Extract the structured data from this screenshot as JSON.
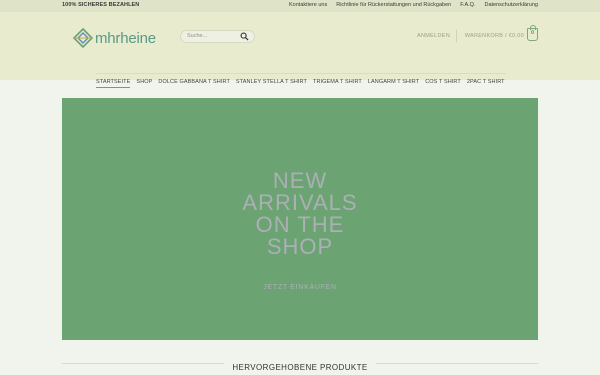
{
  "topbar": {
    "secure_payment": "100% SICHERES BEZAHLEN",
    "links": [
      "Kontaktiere uns",
      "Richtlinie für Rückerstattungen und Rückgaben",
      "F.A.Q.",
      "Datenschutzerklärung"
    ]
  },
  "header": {
    "logo_text": "mhrheine",
    "search_placeholder": "Suche...",
    "account_label": "ANMELDEN",
    "cart_label": "WARENKORB / €0.00",
    "cart_count": "0"
  },
  "nav": {
    "items": [
      "STARTSEITE",
      "SHOP",
      "DOLCE GABBANA T SHIRT",
      "STANLEY STELLA T SHIRT",
      "TRIGEMA T SHIRT",
      "LANGARM T SHIRT",
      "COS T SHIRT",
      "2PAC T SHIRT"
    ]
  },
  "hero": {
    "title": "NEW\nARRIVALS\nON THE\nSHOP",
    "cta": "JETZT EINKAUFEN"
  },
  "featured": {
    "title": "HERVORGEHOBENE PRODUKTE"
  },
  "colors": {
    "accent": "#6ca373",
    "header_bg": "#e8ebcd",
    "topbar_bg": "#dfe3c7"
  }
}
